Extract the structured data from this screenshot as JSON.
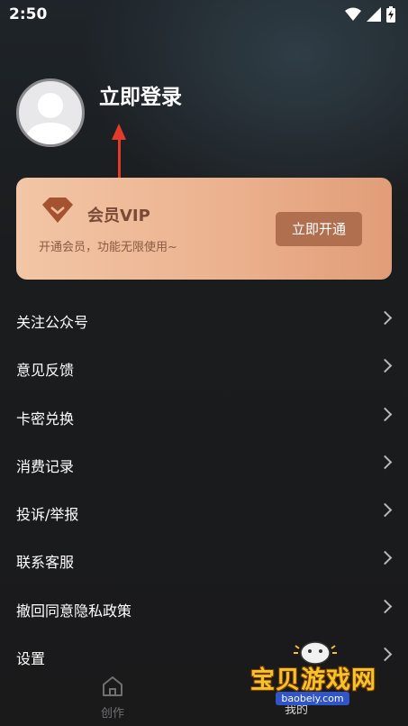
{
  "status_bar": {
    "time": "2:50"
  },
  "profile": {
    "login_label": "立即登录"
  },
  "vip": {
    "title": "会员VIP",
    "subtitle": "开通会员，功能无限使用~",
    "button": "立即开通"
  },
  "menu": {
    "items": [
      {
        "label": "关注公众号"
      },
      {
        "label": "意见反馈"
      },
      {
        "label": "卡密兑换"
      },
      {
        "label": "消费记录"
      },
      {
        "label": "投诉/举报"
      },
      {
        "label": "联系客服"
      },
      {
        "label": "撤回同意隐私政策"
      },
      {
        "label": "设置"
      }
    ]
  },
  "tab_bar": {
    "create_label": "创作",
    "mine_label": "我的"
  },
  "watermark": {
    "text": "宝贝游戏网",
    "url": "baobeiy.com"
  },
  "colors": {
    "vip_gradient_start": "#f2c6a6",
    "vip_gradient_end": "#e19d78",
    "vip_button": "#b06f4e",
    "annotation_arrow": "#e23b2a"
  }
}
